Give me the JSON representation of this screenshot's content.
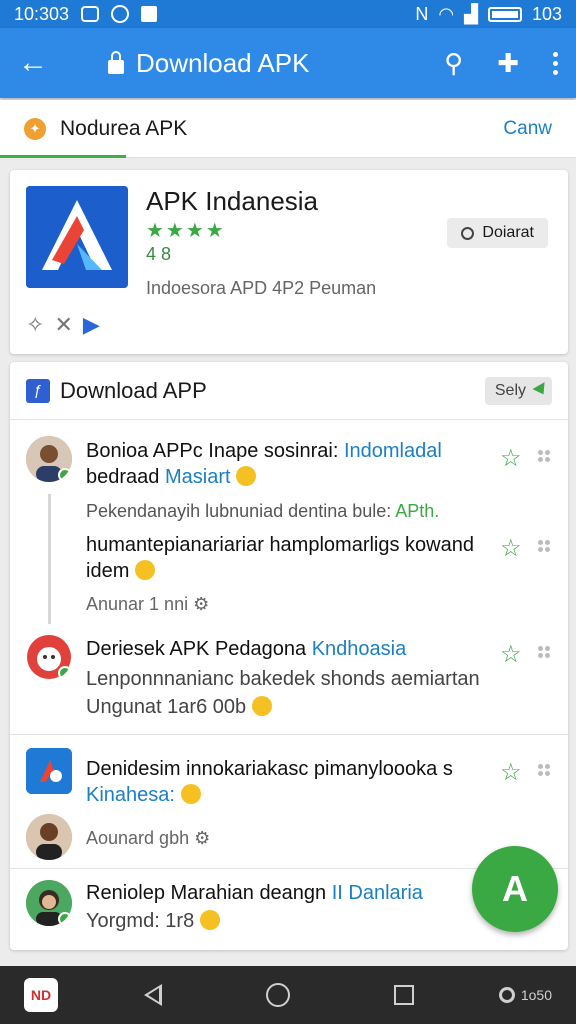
{
  "status_bar": {
    "time": "10:303",
    "battery": "103"
  },
  "app_bar": {
    "title": "Download APK"
  },
  "tab": {
    "label": "Nodurea APK",
    "cancel": "Canw"
  },
  "app_card": {
    "name": "APK Indanesia",
    "stars": "★★★★",
    "rating": "4 8",
    "subtitle": "Indoesora APD 4P2 Peuman",
    "download_label": "Doiarat"
  },
  "list": {
    "title": "Download APP",
    "sort_label": "Sely",
    "items": [
      {
        "line1": "Bonioa APPc Inape sosinrai: ",
        "line1_hl": "Indomladal",
        "line2": "bedraad ",
        "line2_hl": "Masiart",
        "line3": "Pekendanayih lubnuniad dentina bule: ",
        "line3_hl": "APth.",
        "line4": "humantepianariariar hamplomarligs kowand",
        "line5": "idem",
        "meta": "Anunar 1 nni"
      },
      {
        "line1": "Deriesek APK Pedagona ",
        "line1_hl": "Kndhoasia",
        "line2": "Lenponnnanianc bakedek shonds aemiartan",
        "meta": "Ungunat 1ar6 00b"
      },
      {
        "line1": "Denidesim innokariakasc pimanyloooka s",
        "line2_hl": "Kinahesa:",
        "meta": "Aounard gbh"
      },
      {
        "line1": "Reniolep Marahian deangn ",
        "line1_hl": "II Danlaria",
        "meta": "Yorgmd: 1r8"
      }
    ]
  },
  "nav": {
    "extra": "1o50"
  },
  "colors": {
    "primary": "#2e8ae6",
    "accent": "#3aa843",
    "link": "#1b7fc4"
  }
}
